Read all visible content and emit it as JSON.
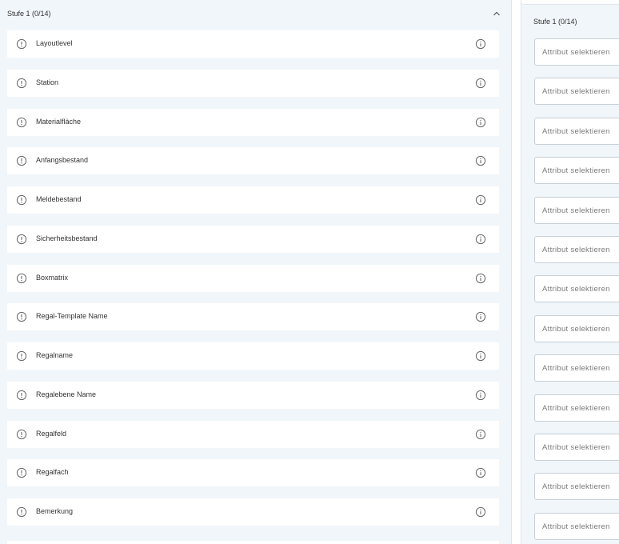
{
  "left_panel": {
    "title": "Stufe 1 (0/14)",
    "rows": [
      {
        "label": "Layoutlevel"
      },
      {
        "label": "Station"
      },
      {
        "label": "Materialfläche"
      },
      {
        "label": "Anfangsbestand"
      },
      {
        "label": "Meldebestand"
      },
      {
        "label": "Sicherheitsbestand"
      },
      {
        "label": "Boxmatrix"
      },
      {
        "label": "Regal-Template Name"
      },
      {
        "label": "Regalname"
      },
      {
        "label": "Regalebene Name"
      },
      {
        "label": "Regalfeld"
      },
      {
        "label": "Regalfach"
      },
      {
        "label": "Bemerkung"
      }
    ]
  },
  "right_panel": {
    "title": "Stufe 1 (0/14)",
    "select_placeholder": "Attribut selektieren",
    "select_count": 13
  },
  "icons": {
    "row_status": "warning-circle-icon",
    "row_info": "info-circle-icon",
    "collapse": "chevron-up-icon"
  }
}
